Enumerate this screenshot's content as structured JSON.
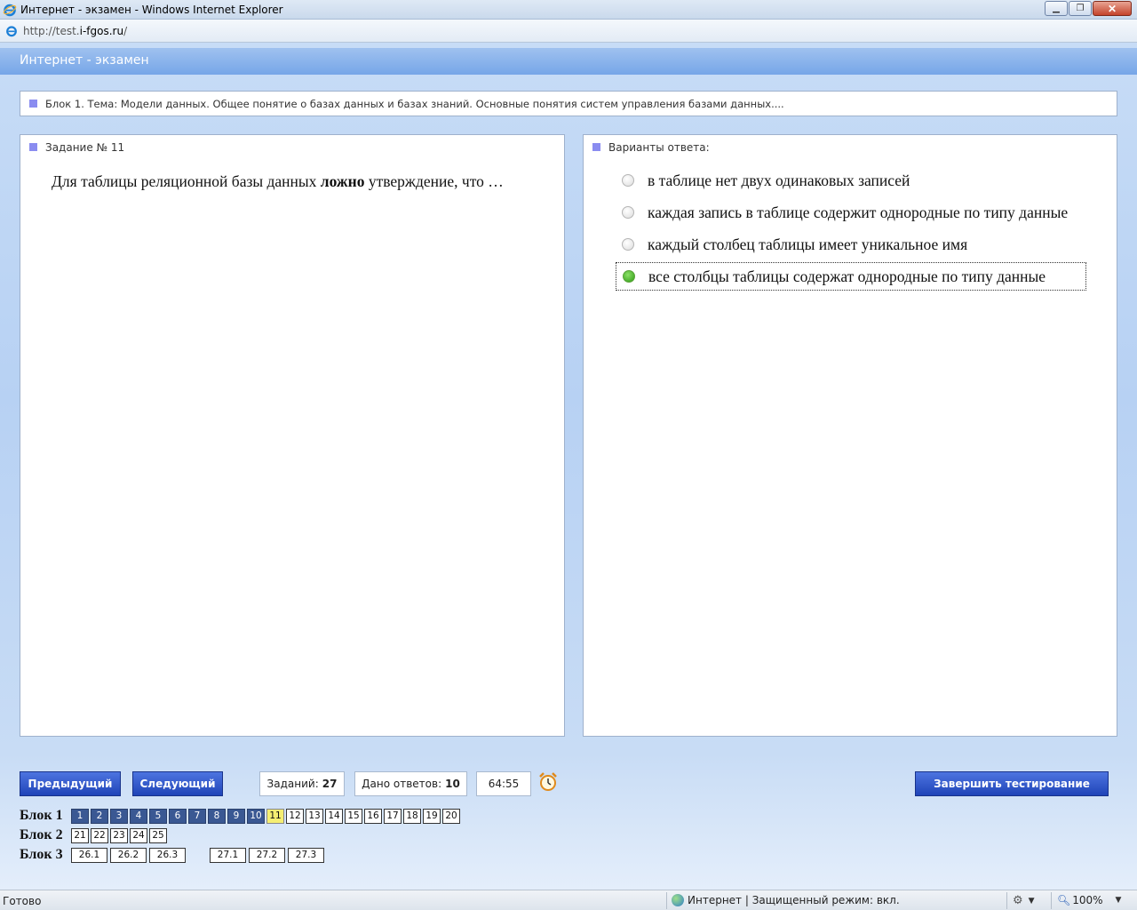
{
  "window": {
    "title": "Интернет - экзамен - Windows Internet Explorer",
    "address_prefix": "http://test.",
    "address_domain": "i-fgos.ru",
    "address_suffix": "/"
  },
  "app": {
    "header": "Интернет - экзамен",
    "block_topic": "Блок 1. Тема: Модели данных. Общее понятие о базах данных и базах знаний. Основные понятия систем управления базами данных....",
    "task": {
      "label": "Задание № 11",
      "question_before": "Для таблицы реляционной базы данных ",
      "question_bold": "ложно",
      "question_after": " утверждение, что …"
    },
    "answers": {
      "label": "Варианты ответа:",
      "options": [
        {
          "text": "в таблице нет двух одинаковых записей",
          "selected": false
        },
        {
          "text": "каждая запись в таблице содержит однородные по типу данные",
          "selected": false
        },
        {
          "text": "каждый столбец таблицы имеет уникальное имя",
          "selected": false
        },
        {
          "text": "все столбцы таблицы содержат однородные по типу данные",
          "selected": true
        }
      ]
    },
    "controls": {
      "prev": "Предыдущий",
      "next": "Следующий",
      "tasks_label": "Заданий:",
      "tasks_value": "27",
      "answered_label": "Дано ответов:",
      "answered_value": "10",
      "timer": "64:55",
      "finish": "Завершить тестирование"
    },
    "blocks": [
      {
        "label": "Блок 1",
        "cells": [
          "1",
          "2",
          "3",
          "4",
          "5",
          "6",
          "7",
          "8",
          "9",
          "10",
          "11",
          "12",
          "13",
          "14",
          "15",
          "16",
          "17",
          "18",
          "19",
          "20"
        ],
        "done_count": 10,
        "current": "11"
      },
      {
        "label": "Блок 2",
        "cells": [
          "21",
          "22",
          "23",
          "24",
          "25"
        ],
        "done_count": 0,
        "current": ""
      },
      {
        "label": "Блок 3",
        "cells_a": [
          "26.1",
          "26.2",
          "26.3"
        ],
        "cells_b": [
          "27.1",
          "27.2",
          "27.3"
        ],
        "done_count": 0,
        "current": ""
      }
    ]
  },
  "status": {
    "left": "Готово",
    "zone": "Интернет | Защищенный режим: вкл.",
    "zoom": "100%"
  },
  "colors": {
    "button": "#2a4fc4",
    "done_cell": "#3a5893",
    "current_cell": "#f5ee72",
    "selected_radio": "#2f9b15"
  }
}
